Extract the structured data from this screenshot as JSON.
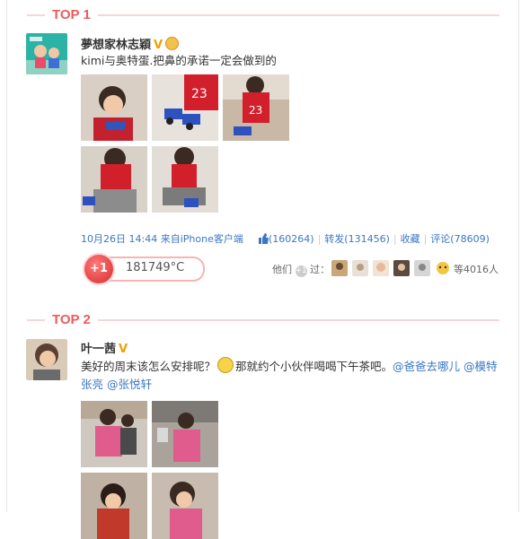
{
  "top1": {
    "rank_label": "TOP 1",
    "user": {
      "name": "夢想家林志穎",
      "v_badge": "V",
      "crown": "crown-icon"
    },
    "text": "kimi与奥特蛋.把鼻的承诺一定会做到的",
    "meta": {
      "time": "10月26日 14:44",
      "from": "来自iPhone客户端"
    },
    "actions": {
      "like": "(160264)",
      "repost": "转发(131456)",
      "favorite": "收藏",
      "comment": "评论(78609)"
    },
    "heat": {
      "plus": "+1",
      "value": "181749°C"
    },
    "who": {
      "prefix": "他们",
      "plus": "+1",
      "suffix": "过：",
      "count": "等4016人"
    }
  },
  "top2": {
    "rank_label": "TOP 2",
    "user": {
      "name": "叶一茜",
      "v_badge": "V"
    },
    "text": {
      "part1": "美好的周末该怎么安排呢？",
      "part2": "那就约个小伙伴喝喝下午茶吧。",
      "link1": "@爸爸去哪儿",
      "link2": "@模特张亮",
      "link3": "@张悦轩"
    }
  },
  "colors": {
    "accent_red": "#ee5b5b",
    "link_blue": "#3a77c2",
    "v_gold": "#f0a000"
  }
}
